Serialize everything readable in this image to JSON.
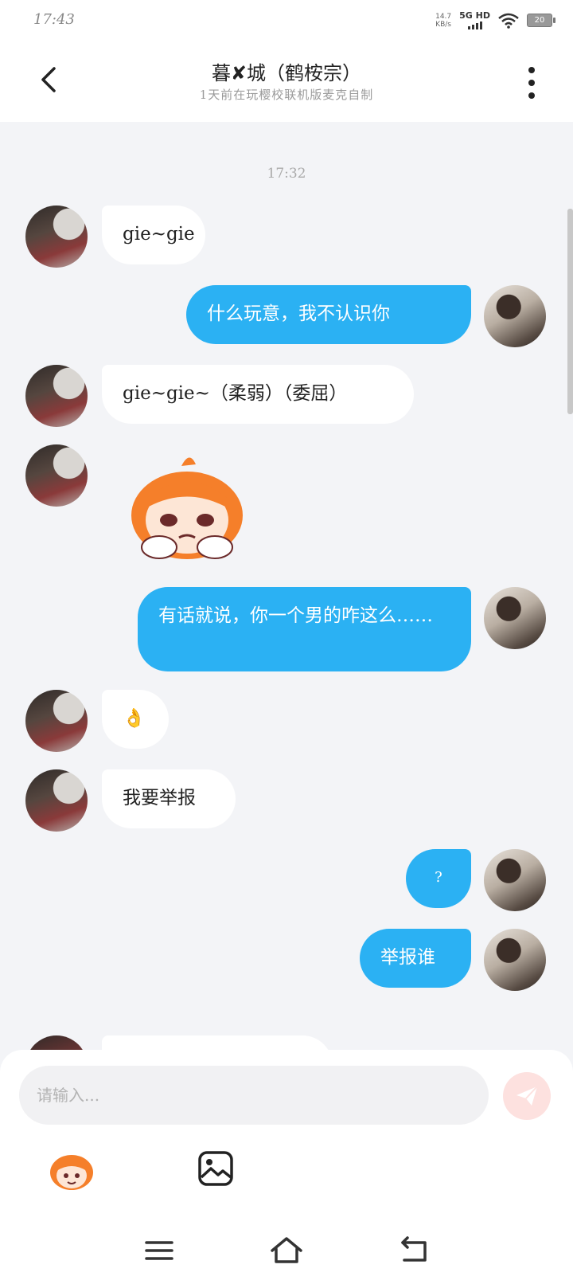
{
  "status_bar": {
    "time": "17:43",
    "net_speed_value": "14.7",
    "net_speed_unit": "KB/s",
    "network": "5G HD",
    "battery": "20"
  },
  "header": {
    "title": "暮✘城（鹤桉宗）",
    "subtitle": "1天前在玩樱校联机版麦克自制"
  },
  "chat": {
    "timestamp": "17:32",
    "messages": [
      {
        "sender": "them",
        "text": "gie~gie"
      },
      {
        "sender": "me",
        "text": "什么玩意，我不认识你"
      },
      {
        "sender": "them",
        "text": "gie~gie~（柔弱）（委屈）"
      },
      {
        "sender": "them",
        "type": "sticker"
      },
      {
        "sender": "me",
        "text": "有话就说，你一个男的咋这么……"
      },
      {
        "sender": "them",
        "text": "👌"
      },
      {
        "sender": "them",
        "text": "我要举报"
      },
      {
        "sender": "me",
        "text": "?"
      },
      {
        "sender": "me",
        "text": "举报谁"
      }
    ]
  },
  "input": {
    "placeholder": "请输入..."
  },
  "colors": {
    "my_bubble": "#2bb1f3",
    "their_bubble": "#ffffff",
    "send_button": "#fde1df",
    "background": "#f3f4f7"
  },
  "icons": [
    "back-icon",
    "more-icon",
    "send-icon",
    "emoji-sticker-icon",
    "image-icon",
    "menu-icon",
    "home-icon",
    "return-icon"
  ]
}
